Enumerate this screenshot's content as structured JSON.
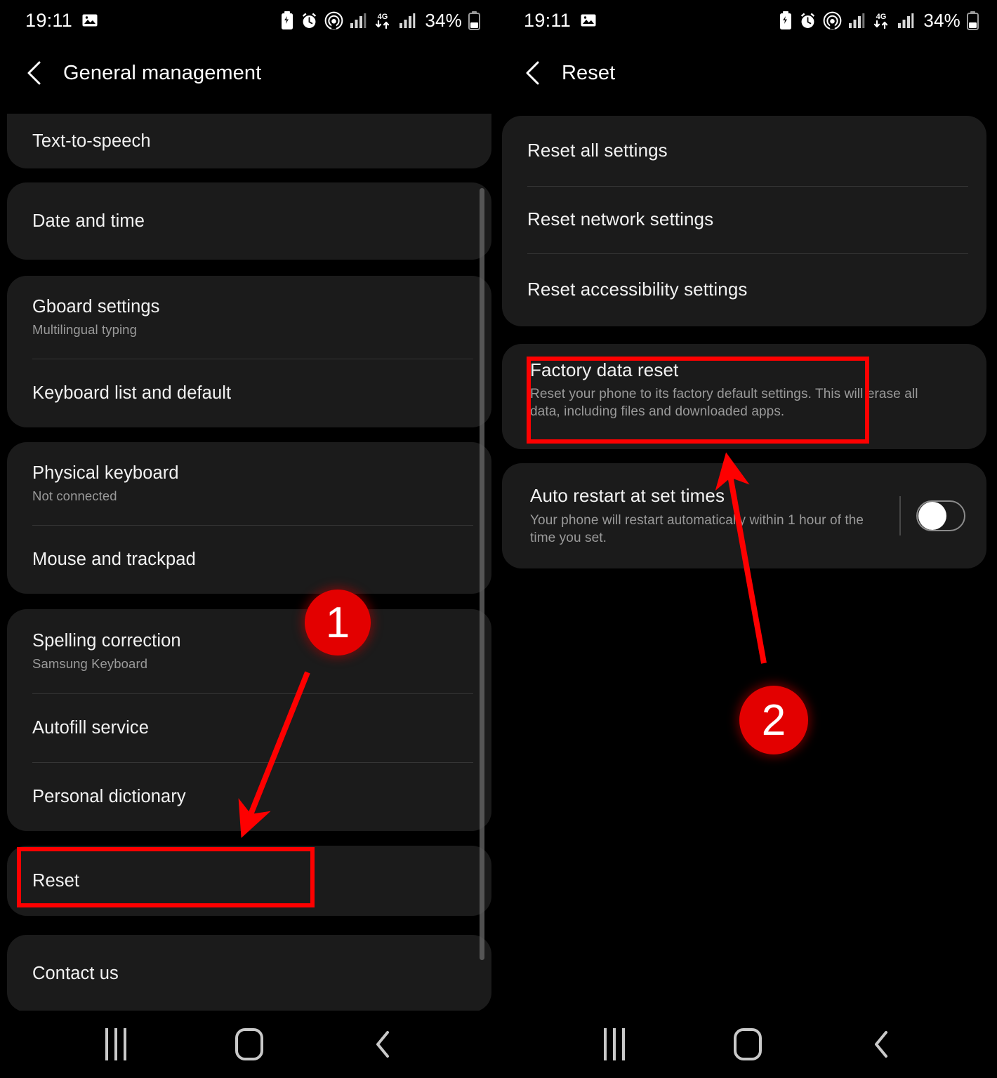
{
  "statusbar": {
    "time": "19:11",
    "battery_percent": "34%",
    "icons_left": [
      "photo-icon"
    ],
    "icons_right": [
      "battery-saver-icon",
      "alarm-icon",
      "hotspot-icon",
      "signal-bars-icon",
      "network-4g-icon",
      "signal-bars-icon",
      "battery-icon"
    ],
    "network_label": "4G"
  },
  "left_panel": {
    "appbar": {
      "back": "back-chevron-icon",
      "title": "General management"
    },
    "groups": [
      {
        "rows": [
          {
            "title": "Text-to-speech"
          }
        ]
      },
      {
        "rows": [
          {
            "title": "Date and time"
          }
        ]
      },
      {
        "rows": [
          {
            "title": "Gboard settings",
            "subtitle": "Multilingual typing"
          },
          {
            "title": "Keyboard list and default"
          }
        ]
      },
      {
        "rows": [
          {
            "title": "Physical keyboard",
            "subtitle": "Not connected"
          },
          {
            "title": "Mouse and trackpad"
          }
        ]
      },
      {
        "rows": [
          {
            "title": "Spelling correction",
            "subtitle": "Samsung Keyboard"
          },
          {
            "title": "Autofill service"
          },
          {
            "title": "Personal dictionary"
          }
        ]
      },
      {
        "rows": [
          {
            "title": "Reset"
          }
        ]
      },
      {
        "rows": [
          {
            "title": "Contact us"
          }
        ]
      }
    ],
    "annotation": {
      "badge": "1",
      "highlight_target": "Reset"
    }
  },
  "right_panel": {
    "appbar": {
      "back": "back-chevron-icon",
      "title": "Reset"
    },
    "groups": [
      {
        "rows": [
          {
            "title": "Reset all settings"
          },
          {
            "title": "Reset network settings"
          },
          {
            "title": "Reset accessibility settings"
          }
        ]
      },
      {
        "rows": [
          {
            "title": "Factory data reset",
            "subtitle": "Reset your phone to its factory default settings. This will erase all data, including files and downloaded apps."
          }
        ]
      },
      {
        "rows": [
          {
            "title": "Auto restart at set times",
            "subtitle": "Your phone will restart automatically within 1 hour of the time you set.",
            "toggle": "off"
          }
        ]
      }
    ],
    "annotation": {
      "badge": "2",
      "highlight_target": "Factory data reset"
    }
  },
  "navbar": {
    "recents_label": "recents-icon",
    "home_label": "home-icon",
    "back_label": "back-icon"
  },
  "colors": {
    "accent_red": "#fe0000",
    "badge_red": "#e30000",
    "card_bg": "#1b1b1b",
    "page_bg": "#000000",
    "title_text": "#f2f2f2",
    "subtitle_text": "#9a9a9a"
  }
}
